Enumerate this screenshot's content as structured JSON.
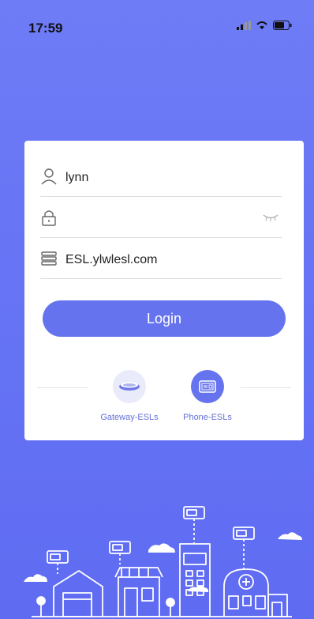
{
  "status": {
    "time": "17:59"
  },
  "login": {
    "username": "lynn",
    "password": "",
    "server": "ESL.ylwlesl.com",
    "button": "Login"
  },
  "modes": [
    {
      "label": "Gateway-ESLs"
    },
    {
      "label": "Phone-ESLs"
    }
  ],
  "colors": {
    "accent": "#6673ef",
    "background": "#6674f5"
  }
}
